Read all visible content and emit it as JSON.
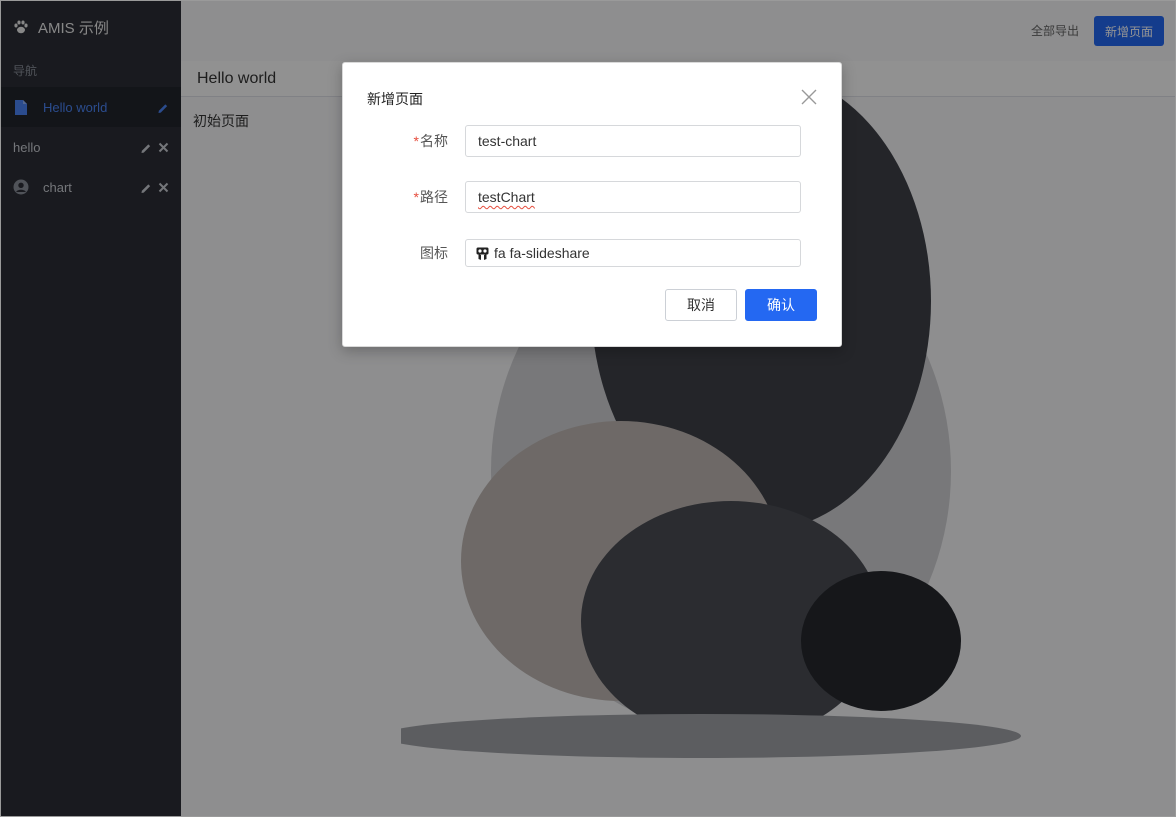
{
  "app": {
    "title": "AMIS 示例"
  },
  "sidebar": {
    "nav_title": "导航",
    "items": [
      {
        "label": "Hello world",
        "icon": "file-icon"
      },
      {
        "label": "hello",
        "icon": ""
      },
      {
        "label": "chart",
        "icon": "user-circle-icon"
      }
    ]
  },
  "header": {
    "export_all": "全部导出",
    "new_page": "新增页面"
  },
  "page": {
    "title": "Hello world",
    "body": "初始页面"
  },
  "modal": {
    "title": "新增页面",
    "name_label": "名称",
    "name_value": "test-chart",
    "path_label": "路径",
    "path_value": "testChart",
    "icon_label": "图标",
    "icon_value": "fa fa-slideshare",
    "cancel_label": "取消",
    "confirm_label": "确认",
    "required_mark": "*"
  },
  "colors": {
    "primary": "#2468f2",
    "sidebar_bg": "#2b2e36",
    "active_link": "#4a84f5",
    "required": "#e64d3d"
  }
}
